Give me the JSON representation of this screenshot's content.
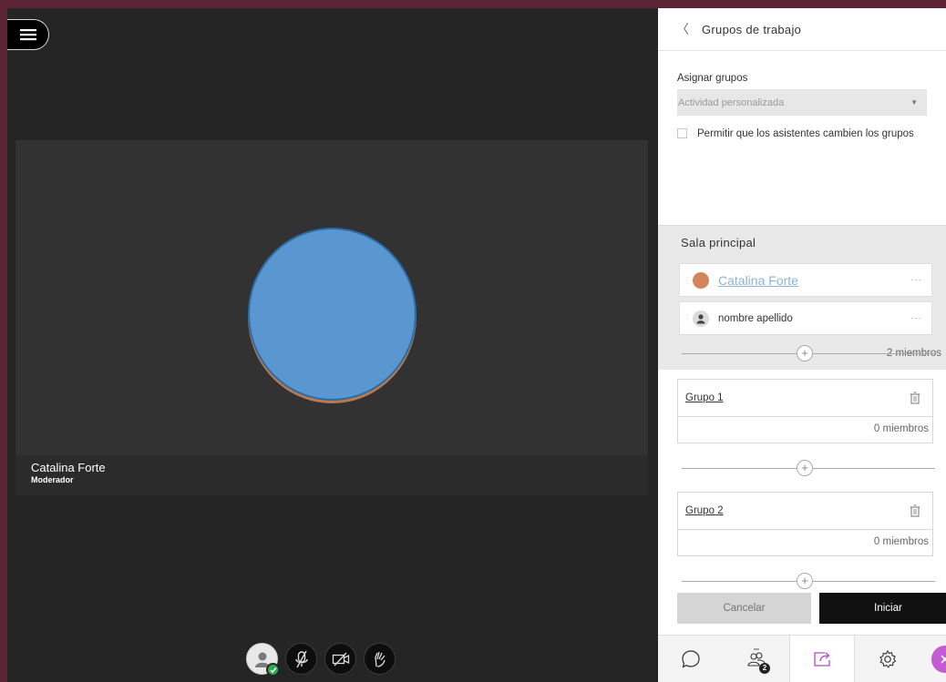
{
  "panel": {
    "title": "Grupos de trabajo",
    "assign_label": "Asignar grupos",
    "assign_value": "Actividad personalizada",
    "permit_text": "Permitir que los asistentes cambien los grupos",
    "main_room": {
      "title": "Sala principal",
      "members": [
        {
          "name": "Catalina Forte"
        },
        {
          "name": "nombre apellido"
        }
      ],
      "count": "2 miembros"
    },
    "groups": [
      {
        "name": "Grupo 1",
        "count": "0 miembros"
      },
      {
        "name": "Grupo 2",
        "count": "0 miembros"
      }
    ],
    "cancel_label": "Cancelar",
    "start_label": "Iniciar",
    "tabs": [
      {
        "icon": "chat-icon"
      },
      {
        "icon": "attendees-icon",
        "badge": "2"
      },
      {
        "icon": "share-content-icon"
      },
      {
        "icon": "settings-icon"
      },
      {
        "icon": "close-icon"
      }
    ]
  },
  "stage": {
    "presenter_name": "Catalina Forte",
    "presenter_role": "Moderador",
    "controls": [
      "profile-icon",
      "microphone-muted-icon",
      "camera-off-icon",
      "raise-hand-icon"
    ]
  },
  "colors": {
    "frame": "#5c2434",
    "stage_bg": "#252525",
    "avatar": "#5a97d0",
    "accent_close": "#c35cd4",
    "status_green": "#2fa84f"
  }
}
